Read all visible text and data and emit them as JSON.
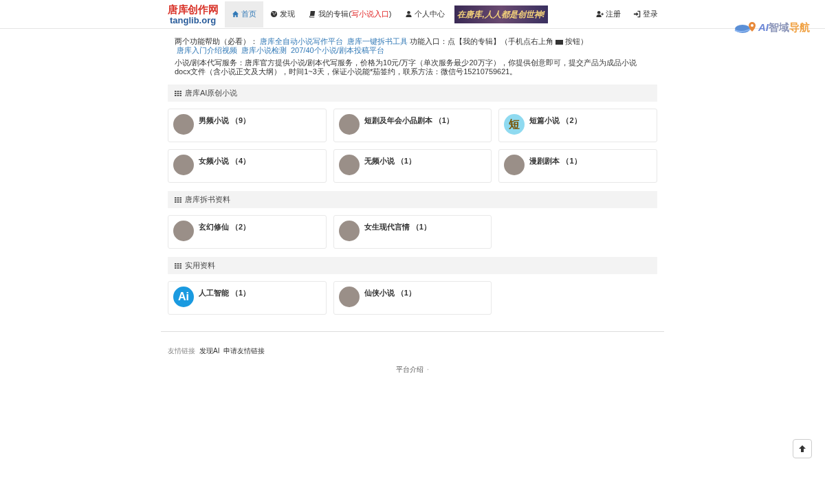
{
  "logo": {
    "title": "唐库创作网",
    "domain": "tanglib.org"
  },
  "nav": [
    {
      "label": "首页",
      "selected": true
    },
    {
      "label": "发现",
      "selected": false
    },
    {
      "label": "我的专辑(",
      "highlight": "写小说入口",
      "label_end": ")",
      "selected": false
    },
    {
      "label": "个人中心",
      "selected": false
    }
  ],
  "banner": {
    "text": "在唐库,人人都是创世神!"
  },
  "user_nav": [
    {
      "label": "注册"
    },
    {
      "label": "登录"
    }
  ],
  "badge": {
    "prefix": "AI",
    "text": "智域",
    "suffix": "导航"
  },
  "help": [
    {
      "kind": "text",
      "text": "两个功能帮助（必看）："
    },
    {
      "kind": "link",
      "text": "唐库全自动小说写作平台"
    },
    {
      "kind": "link",
      "text": "唐库一键拆书工具"
    },
    {
      "kind": "text",
      "text": "功能入口：点【我的专辑】（手机点右上角"
    },
    {
      "kind": "icon"
    },
    {
      "kind": "text",
      "text": "按钮）"
    },
    {
      "kind": "link",
      "text": "唐库入门介绍视频"
    },
    {
      "kind": "link",
      "text": "唐库小说检测"
    },
    {
      "kind": "link",
      "text": "207/40个小说/剧本投稿平台"
    }
  ],
  "service": "小说/剧本代写服务：唐库官方提供小说/剧本代写服务，价格为10元/万字（单次服务最少20万字），你提供创意即可，提交产品为成品小说docx文件（含小说正文及大纲），时间1~3天，保证小说能*茄签约，联系方法：微信号15210759621。",
  "sections": [
    {
      "title": "唐库AI原创小说",
      "items": [
        {
          "name": "男频小说",
          "count": "（9）"
        },
        {
          "name": "短剧及年会小品剧本",
          "count": "（1）"
        },
        {
          "name": "短篇小说",
          "count": "（2）",
          "avatar_text": "短"
        },
        {
          "name": "女频小说",
          "count": "（4）"
        },
        {
          "name": "无频小说",
          "count": "（1）"
        },
        {
          "name": "漫剧剧本",
          "count": "（1）"
        }
      ]
    },
    {
      "title": "唐库拆书资料",
      "items": [
        {
          "name": "玄幻修仙",
          "count": "（2）"
        },
        {
          "name": "女生现代言情",
          "count": "（1）"
        }
      ]
    },
    {
      "title": "实用资料",
      "items": [
        {
          "name": "人工智能",
          "count": "（1）",
          "avatar_text": "Ai"
        },
        {
          "name": "仙侠小说",
          "count": "（1）"
        }
      ]
    }
  ],
  "footer": {
    "links_label": "友情链接",
    "links": [
      "发现AI",
      "申请友情链接"
    ],
    "bottom": "平台介绍",
    "separator": "·"
  }
}
